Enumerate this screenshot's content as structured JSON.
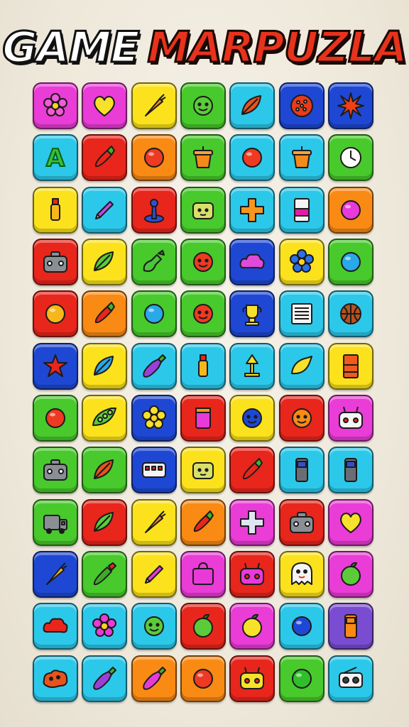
{
  "title": {
    "part1": "GAME",
    "part2": "MARPUZLA"
  },
  "colors": {
    "pink": "#ea3cd6",
    "yellow": "#fbe21c",
    "green": "#48c92c",
    "cyan": "#2cc8ea",
    "blue": "#1e48d4",
    "red": "#e8261c",
    "orange": "#f98a14",
    "purple": "#7a4cd2"
  },
  "grid": {
    "rows": 12,
    "cols": 7,
    "tiles": [
      [
        {
          "bg": "pink",
          "icon": "flower-icon"
        },
        {
          "bg": "pink",
          "icon": "heart-icon"
        },
        {
          "bg": "yellow",
          "icon": "carrot-icon"
        },
        {
          "bg": "green",
          "icon": "smiley-icon"
        },
        {
          "bg": "cyan",
          "icon": "leaf-icon"
        },
        {
          "bg": "blue",
          "icon": "pizza-icon"
        },
        {
          "bg": "blue",
          "icon": "starburst-icon"
        }
      ],
      [
        {
          "bg": "cyan",
          "icon": "letter-a-icon",
          "text": "A"
        },
        {
          "bg": "red",
          "icon": "pepper-icon"
        },
        {
          "bg": "orange",
          "icon": "ball-icon"
        },
        {
          "bg": "green",
          "icon": "pot-icon"
        },
        {
          "bg": "cyan",
          "icon": "ball-icon"
        },
        {
          "bg": "cyan",
          "icon": "pot-icon"
        },
        {
          "bg": "green",
          "icon": "clock-icon"
        }
      ],
      [
        {
          "bg": "yellow",
          "icon": "bottle-icon"
        },
        {
          "bg": "cyan",
          "icon": "pencil-icon"
        },
        {
          "bg": "red",
          "icon": "joystick-icon"
        },
        {
          "bg": "green",
          "icon": "cheese-face-icon"
        },
        {
          "bg": "cyan",
          "icon": "cross-icon"
        },
        {
          "bg": "cyan",
          "icon": "card-icon"
        },
        {
          "bg": "orange",
          "icon": "ball-icon"
        }
      ],
      [
        {
          "bg": "red",
          "icon": "robot-box-icon"
        },
        {
          "bg": "yellow",
          "icon": "leaf-icon"
        },
        {
          "bg": "green",
          "icon": "gourd-icon"
        },
        {
          "bg": "green",
          "icon": "smiley-icon"
        },
        {
          "bg": "blue",
          "icon": "cloud-icon"
        },
        {
          "bg": "yellow",
          "icon": "flower-icon"
        },
        {
          "bg": "green",
          "icon": "ball-icon"
        }
      ],
      [
        {
          "bg": "red",
          "icon": "ball-icon"
        },
        {
          "bg": "orange",
          "icon": "pepper-icon"
        },
        {
          "bg": "green",
          "icon": "ball-icon"
        },
        {
          "bg": "green",
          "icon": "smiley-icon"
        },
        {
          "bg": "blue",
          "icon": "trophy-icon"
        },
        {
          "bg": "cyan",
          "icon": "notepad-icon"
        },
        {
          "bg": "cyan",
          "icon": "basketball-icon"
        }
      ],
      [
        {
          "bg": "blue",
          "icon": "star-icon"
        },
        {
          "bg": "yellow",
          "icon": "leaf-icon"
        },
        {
          "bg": "cyan",
          "icon": "eggplant-icon"
        },
        {
          "bg": "cyan",
          "icon": "bottle-icon"
        },
        {
          "bg": "cyan",
          "icon": "lamp-icon"
        },
        {
          "bg": "cyan",
          "icon": "lemon-icon"
        },
        {
          "bg": "yellow",
          "icon": "card-icon"
        }
      ],
      [
        {
          "bg": "green",
          "icon": "ball-icon"
        },
        {
          "bg": "yellow",
          "icon": "pea-icon"
        },
        {
          "bg": "blue",
          "icon": "flower-icon"
        },
        {
          "bg": "red",
          "icon": "cup-icon"
        },
        {
          "bg": "yellow",
          "icon": "smiley-icon"
        },
        {
          "bg": "red",
          "icon": "smiley-icon"
        },
        {
          "bg": "pink",
          "icon": "robot-face-icon"
        }
      ],
      [
        {
          "bg": "green",
          "icon": "robot-box-icon"
        },
        {
          "bg": "green",
          "icon": "leaf-icon"
        },
        {
          "bg": "blue",
          "icon": "bus-icon"
        },
        {
          "bg": "yellow",
          "icon": "cheese-face-icon"
        },
        {
          "bg": "red",
          "icon": "pepper-icon"
        },
        {
          "bg": "cyan",
          "icon": "phone-icon"
        },
        {
          "bg": "cyan",
          "icon": "phone-icon"
        }
      ],
      [
        {
          "bg": "green",
          "icon": "truck-icon"
        },
        {
          "bg": "red",
          "icon": "leaf-icon"
        },
        {
          "bg": "yellow",
          "icon": "carrot-icon"
        },
        {
          "bg": "orange",
          "icon": "pepper-icon"
        },
        {
          "bg": "pink",
          "icon": "cross-icon"
        },
        {
          "bg": "red",
          "icon": "robot-box-icon"
        },
        {
          "bg": "pink",
          "icon": "heart-icon"
        }
      ],
      [
        {
          "bg": "blue",
          "icon": "carrot-icon"
        },
        {
          "bg": "green",
          "icon": "cucumber-icon"
        },
        {
          "bg": "yellow",
          "icon": "pencil-icon"
        },
        {
          "bg": "pink",
          "icon": "bag-icon"
        },
        {
          "bg": "red",
          "icon": "robot-face-icon"
        },
        {
          "bg": "yellow",
          "icon": "ghost-icon"
        },
        {
          "bg": "pink",
          "icon": "apple-icon"
        }
      ],
      [
        {
          "bg": "cyan",
          "icon": "cloud-icon"
        },
        {
          "bg": "cyan",
          "icon": "flower-icon"
        },
        {
          "bg": "cyan",
          "icon": "smiley-icon"
        },
        {
          "bg": "red",
          "icon": "apple-icon"
        },
        {
          "bg": "pink",
          "icon": "apple-icon"
        },
        {
          "bg": "cyan",
          "icon": "ball-icon"
        },
        {
          "bg": "purple",
          "icon": "phone-icon"
        }
      ],
      [
        {
          "bg": "cyan",
          "icon": "potato-icon"
        },
        {
          "bg": "cyan",
          "icon": "eggplant-icon"
        },
        {
          "bg": "orange",
          "icon": "eggplant-icon"
        },
        {
          "bg": "orange",
          "icon": "ball-icon"
        },
        {
          "bg": "red",
          "icon": "robot-face-icon"
        },
        {
          "bg": "green",
          "icon": "ball-icon"
        },
        {
          "bg": "cyan",
          "icon": "radio-icon"
        }
      ]
    ]
  }
}
